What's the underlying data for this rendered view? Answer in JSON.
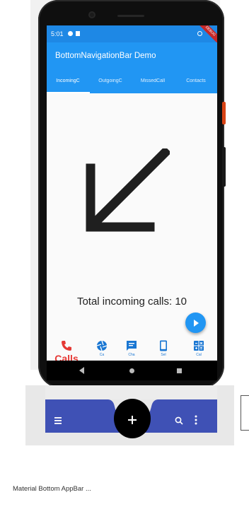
{
  "status_bar": {
    "time": "5:01",
    "ribbon": "DEBUG"
  },
  "app_bar": {
    "title": "BottomNavigationBar Demo"
  },
  "tabs": [
    {
      "label": "IncomingC",
      "selected": true
    },
    {
      "label": "OutgoingC",
      "selected": false
    },
    {
      "label": "MissedCall",
      "selected": false
    },
    {
      "label": "Contacts",
      "selected": false
    }
  ],
  "content": {
    "total_text": "Total incoming calls: 10"
  },
  "bottom_nav": [
    {
      "label": "Calls",
      "icon": "phone-icon",
      "active": true
    },
    {
      "label": "Ca",
      "icon": "camera-shutter-icon",
      "active": false
    },
    {
      "label": "Cha",
      "icon": "chat-icon",
      "active": false
    },
    {
      "label": "Sel",
      "icon": "phone-device-icon",
      "active": false
    },
    {
      "label": "Cal",
      "icon": "calculator-icon",
      "active": false
    }
  ],
  "preview": {
    "caption": "Material Bottom AppBar ..."
  },
  "colors": {
    "primary": "#2196f3",
    "status": "#1e88e5",
    "active": "#e53935",
    "preview_bar": "#3f51b5"
  }
}
